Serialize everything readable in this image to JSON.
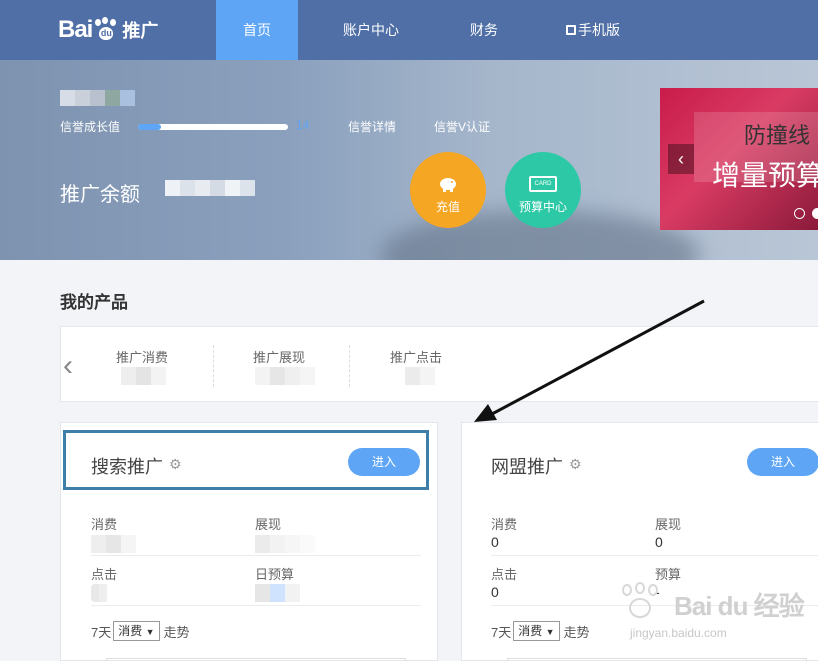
{
  "nav": {
    "logo_text": "Bai",
    "logo_paw_text": "du",
    "logo_suffix": "推广",
    "items": [
      {
        "label": "首页",
        "active": true
      },
      {
        "label": "账户中心",
        "active": false
      },
      {
        "label": "财务",
        "active": false
      },
      {
        "label": "手机版",
        "active": false,
        "icon": "qr-code-icon"
      }
    ]
  },
  "banner": {
    "credit_growth_label": "信誉成长值",
    "credit_growth_value": "14",
    "credit_growth_progress": 0.15,
    "credit_details_label": "信誉详情",
    "credit_v_label": "信誉V认证",
    "balance_label": "推广余额",
    "recharge_label": "充值",
    "budget_center_label": "预算中心",
    "budget_card_text": "CARD",
    "ad": {
      "line1": "防撞线",
      "line2": "增量预算",
      "prev": "‹"
    }
  },
  "products": {
    "title": "我的产品",
    "carousel_prev": "‹",
    "metrics": [
      "推广消费",
      "推广展现",
      "推广点击"
    ]
  },
  "cards": [
    {
      "name": "搜索推广",
      "enter_label": "进入",
      "fields": [
        {
          "label": "消费",
          "value": ""
        },
        {
          "label": "展现",
          "value": ""
        },
        {
          "label": "点击",
          "value": ""
        },
        {
          "label": "日预算",
          "value": ""
        }
      ],
      "trend_prefix": "7天",
      "trend_select": "消费",
      "trend_suffix": "走势"
    },
    {
      "name": "网盟推广",
      "enter_label": "进入",
      "fields": [
        {
          "label": "消费",
          "value": "0"
        },
        {
          "label": "展现",
          "value": "0"
        },
        {
          "label": "点击",
          "value": "0"
        },
        {
          "label": "预算",
          "value": "-"
        }
      ],
      "trend_prefix": "7天",
      "trend_select": "消费",
      "trend_suffix": "走势"
    }
  ],
  "watermark": {
    "text": "Bai du 经验",
    "sub": "jingyan.baidu.com"
  },
  "colors": {
    "nav_bg": "#4f6fa6",
    "accent": "#5ea5f5",
    "recharge": "#f5a623",
    "budget": "#2dc9a6",
    "highlight_border": "#3d7fa8"
  }
}
